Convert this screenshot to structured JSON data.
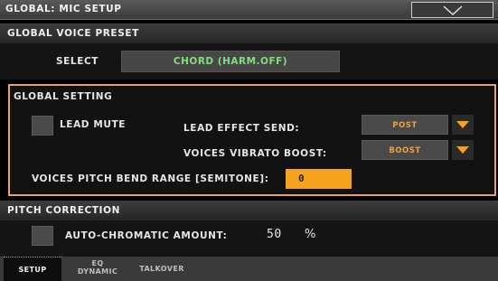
{
  "window": {
    "title": "GLOBAL: MIC SETUP"
  },
  "voice_preset": {
    "section_title": "GLOBAL VOICE PRESET",
    "select_label": "SELECT",
    "select_value": "CHORD (HARM.OFF)"
  },
  "global_setting": {
    "section_title": "GLOBAL SETTING",
    "lead_mute_label": "LEAD MUTE",
    "lead_mute_checked": false,
    "lead_effect_send_label": "LEAD EFFECT SEND:",
    "lead_effect_send_value": "POST",
    "voices_vibrato_boost_label": "VOICES VIBRATO BOOST:",
    "voices_vibrato_boost_value": "BOOST",
    "pitch_bend_range_label": "VOICES PITCH BEND RANGE [SEMITONE]:",
    "pitch_bend_range_value": "0"
  },
  "pitch_correction": {
    "section_title": "PITCH CORRECTION",
    "auto_chromatic_label": "AUTO-CHROMATIC AMOUNT:",
    "auto_chromatic_checked": false,
    "auto_chromatic_value": "50",
    "auto_chromatic_unit": "%"
  },
  "tabs": [
    {
      "label": "SETUP",
      "active": true
    },
    {
      "label_line1": "EQ",
      "label_line2": "DYNAMIC",
      "active": false
    },
    {
      "label": "TALKOVER",
      "active": false
    }
  ],
  "colors": {
    "accent_orange": "#f5a21f",
    "frame_orange": "#e9a26e",
    "value_green": "#7fe07a"
  },
  "icons": {
    "menu": "chevron-down-icon",
    "dropdown": "triangle-down-icon"
  }
}
